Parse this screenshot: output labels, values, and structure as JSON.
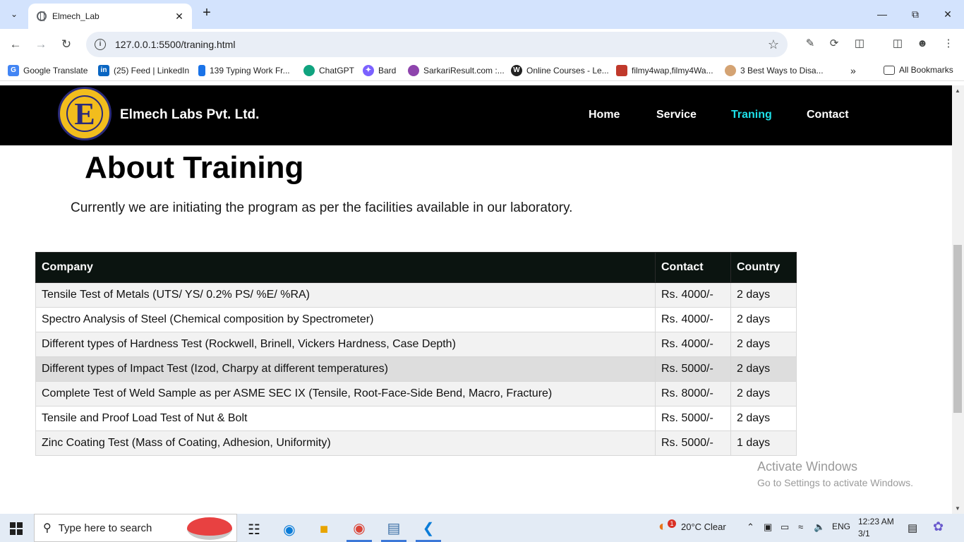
{
  "browser": {
    "tab_title": "Elmech_Lab",
    "url": "127.0.0.1:5500/traning.html",
    "bookmarks": [
      {
        "label": "Google Translate",
        "icon": "google-translate-icon",
        "color": "#4285f4"
      },
      {
        "label": "(25) Feed | LinkedIn",
        "icon": "linkedin-icon",
        "color": "#0a66c2"
      },
      {
        "label": "139 Typing Work Fr...",
        "icon": "typing-icon",
        "color": "#1a73e8"
      },
      {
        "label": "ChatGPT",
        "icon": "chatgpt-icon",
        "color": "#10a37f"
      },
      {
        "label": "Bard",
        "icon": "bard-icon",
        "color": "#7b61ff"
      },
      {
        "label": "SarkariResult.com :...",
        "icon": "sarkari-icon",
        "color": "#8e44ad"
      },
      {
        "label": "Online Courses - Le...",
        "icon": "wordpress-icon",
        "color": "#222222"
      },
      {
        "label": "filmy4wap,filmy4Wa...",
        "icon": "filmy-icon",
        "color": "#c0392b"
      },
      {
        "label": "3 Best Ways to Disa...",
        "icon": "avatar-icon",
        "color": "#d4a373"
      }
    ],
    "all_bookmarks": "All Bookmarks"
  },
  "site": {
    "brand": "Elmech Labs Pvt. Ltd.",
    "logo_letter": "E",
    "nav": [
      "Home",
      "Service",
      "Traning",
      "Contact"
    ],
    "active_nav": "Traning",
    "accent": "#1ee0e8"
  },
  "main": {
    "title": "About Training",
    "intro": "Currently we are initiating the program as per the facilities available in our laboratory.",
    "table": {
      "headers": [
        "Company",
        "Contact",
        "Country"
      ],
      "rows": [
        [
          "Tensile Test of Metals (UTS/ YS/ 0.2% PS/ %E/ %RA)",
          "Rs. 4000/-",
          "2 days"
        ],
        [
          "Spectro Analysis of Steel (Chemical composition by Spectrometer)",
          "Rs. 4000/-",
          "2 days"
        ],
        [
          "Different types of Hardness Test (Rockwell, Brinell, Vickers Hardness, Case Depth)",
          "Rs. 4000/-",
          "2 days"
        ],
        [
          "Different types of Impact Test (Izod, Charpy at different temperatures)",
          "Rs. 5000/-",
          "2 days"
        ],
        [
          "Complete Test of Weld Sample as per ASME SEC IX (Tensile, Root-Face-Side Bend, Macro, Fracture)",
          "Rs. 8000/-",
          "2 days"
        ],
        [
          "Tensile and Proof Load Test of Nut & Bolt",
          "Rs. 5000/-",
          "2 days"
        ],
        [
          "Zinc Coating Test (Mass of Coating, Adhesion, Uniformity)",
          "Rs. 5000/-",
          "1 days"
        ]
      ]
    }
  },
  "watermark": {
    "line1": "Activate Windows",
    "line2": "Go to Settings to activate Windows."
  },
  "taskbar": {
    "search_placeholder": "Type here to search",
    "weather": "20°C  Clear",
    "weather_badge": "1",
    "language": "ENG",
    "time": "12:23 AM",
    "date": "3/1"
  }
}
